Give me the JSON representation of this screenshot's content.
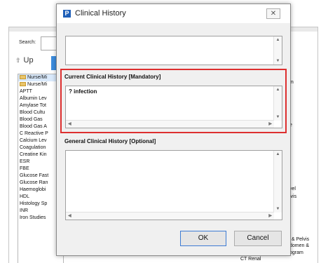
{
  "background": {
    "search_label": "Search:",
    "up_label": "Up",
    "list_items": [
      {
        "label": "Nurse/Mi",
        "folder": true,
        "selected": true
      },
      {
        "label": "Nurse/Mi",
        "folder": true,
        "selected": false
      },
      {
        "label": "APTT",
        "folder": false,
        "selected": false
      },
      {
        "label": "Albumin Lev",
        "folder": false,
        "selected": false
      },
      {
        "label": "Amylase Tot",
        "folder": false,
        "selected": false
      },
      {
        "label": "Blood Cultu",
        "folder": false,
        "selected": false
      },
      {
        "label": "Blood Gas",
        "folder": false,
        "selected": false
      },
      {
        "label": "Blood Gas A",
        "folder": false,
        "selected": false
      },
      {
        "label": "C Reactive P",
        "folder": false,
        "selected": false
      },
      {
        "label": "Calcium Lev",
        "folder": false,
        "selected": false
      },
      {
        "label": "Coagulation",
        "folder": false,
        "selected": false
      },
      {
        "label": "Creatine Kin",
        "folder": false,
        "selected": false
      },
      {
        "label": "ESR",
        "folder": false,
        "selected": false
      },
      {
        "label": "FBE",
        "folder": false,
        "selected": false
      },
      {
        "label": "Glucose Fast",
        "folder": false,
        "selected": false
      },
      {
        "label": "Glucose Ran",
        "folder": false,
        "selected": false
      },
      {
        "label": "Haemoglobi",
        "folder": false,
        "selected": false
      },
      {
        "label": "HDL",
        "folder": false,
        "selected": false
      },
      {
        "label": "Histology Sp",
        "folder": false,
        "selected": false
      },
      {
        "label": "INR",
        "folder": false,
        "selected": false
      },
      {
        "label": "Iron Studies",
        "folder": false,
        "selected": false
      }
    ],
    "right_fragments": [
      "m",
      "e",
      "vel",
      "lvis",
      "n & Pelvis",
      "domen &",
      "ogram"
    ],
    "bottom_right_label": "CT Renal"
  },
  "dialog": {
    "title": "Clinical History",
    "app_icon_letter": "P",
    "top_text": "",
    "current_label": "Current Clinical History [Mandatory]",
    "current_value": "? infection",
    "general_label": "General Clinical History [Optional]",
    "general_value": "",
    "ok_label": "OK",
    "cancel_label": "Cancel"
  },
  "colors": {
    "highlight": "#dd2f2f",
    "accent": "#3c8dde",
    "app_icon": "#1f5fb8"
  }
}
